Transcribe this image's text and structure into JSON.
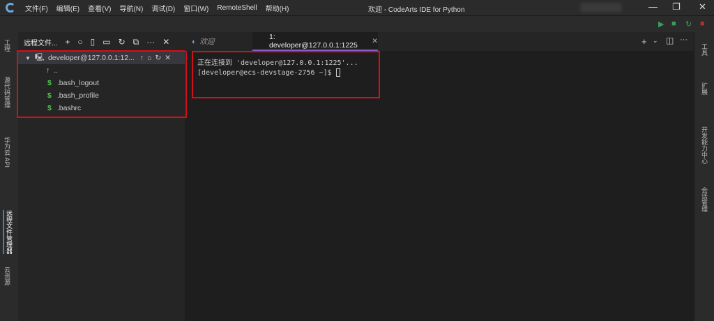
{
  "menubar": {
    "items": [
      "文件(F)",
      "编辑(E)",
      "查看(V)",
      "导航(N)",
      "调试(D)",
      "窗口(W)",
      "RemoteShell",
      "帮助(H)"
    ],
    "title": "欢迎 - CodeArts IDE for Python"
  },
  "activity": [
    "工程",
    "源代码管理",
    "华为云 API",
    "远程文件管理器",
    "云资源"
  ],
  "right_bar": [
    "工具",
    "扩展",
    "开发能力中心",
    "会话管理"
  ],
  "side": {
    "title": "远程文件...",
    "root": "developer@127.0.0.1:12...",
    "parent": "..",
    "files": [
      ".bash_logout",
      ".bash_profile",
      ".bashrc"
    ]
  },
  "tabs": [
    {
      "label": "欢迎"
    },
    {
      "label": "1: developer@127.0.0.1:1225"
    }
  ],
  "terminal": {
    "line1": "正在连接到 'developer@127.0.0.1:1225'...",
    "line2": "[developer@ecs-devstage-2756 ~]$ "
  },
  "colors": {
    "highlight": "#d0101a",
    "accent": "#8a5cc7"
  }
}
